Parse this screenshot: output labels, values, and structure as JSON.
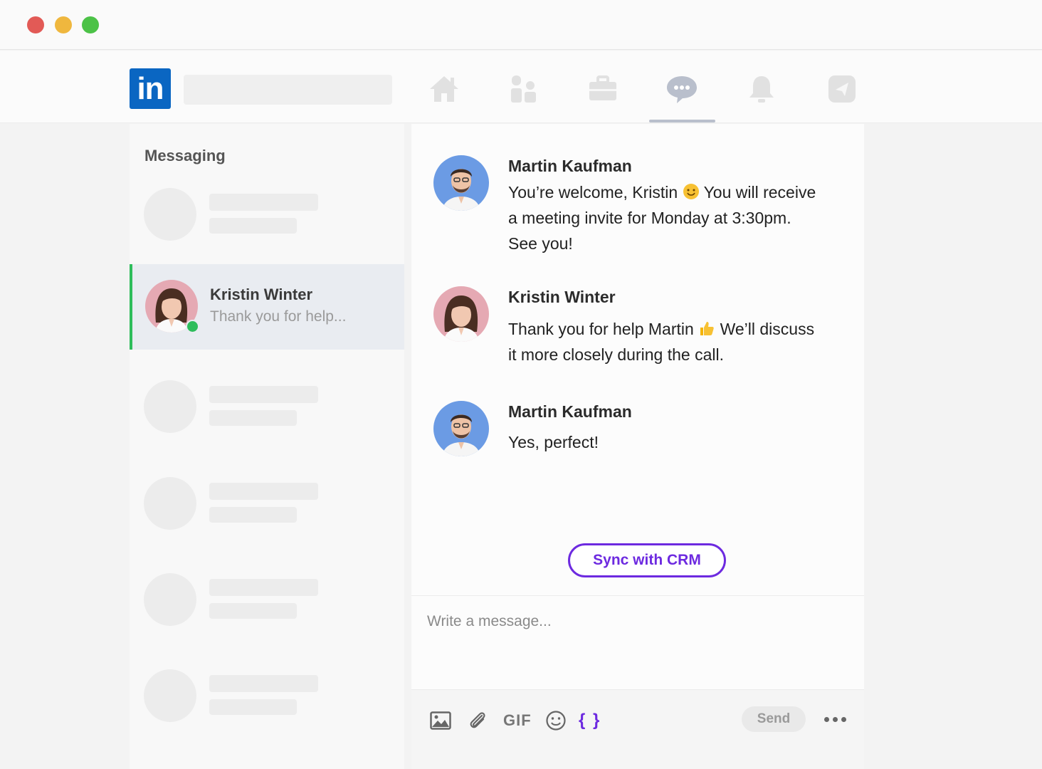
{
  "brand": {
    "logo_text": "in",
    "color": "#0a66c2"
  },
  "nav": {
    "icons": [
      "home-icon",
      "network-icon",
      "jobs-icon",
      "messaging-icon",
      "notifications-icon",
      "send-icon"
    ],
    "active": "messaging-icon"
  },
  "sidebar": {
    "title": "Messaging",
    "active_conversation": {
      "name": "Kristin Winter",
      "preview": "Thank you for help...",
      "online": true
    }
  },
  "chat": {
    "messages": [
      {
        "sender": "Martin Kaufman",
        "lines": [
          "You’re welcome, Kristin",
          "You will receive",
          "a meeting invite for Monday at 3:30pm.",
          "See you!"
        ]
      },
      {
        "sender": "Kristin Winter",
        "lines": [
          "Thank you for help Martin",
          "We’ll discuss",
          "it more closely during the call."
        ]
      },
      {
        "sender": "Martin Kaufman",
        "lines": [
          "Yes, perfect!"
        ]
      }
    ],
    "sync_button": "Sync with CRM",
    "compose_placeholder": "Write a message...",
    "toolbar": {
      "gif_label": "GIF",
      "braces_label": "{ }",
      "send_label": "Send"
    }
  },
  "colors": {
    "accent": "#6d2ae0",
    "online": "#2ebd5b"
  }
}
